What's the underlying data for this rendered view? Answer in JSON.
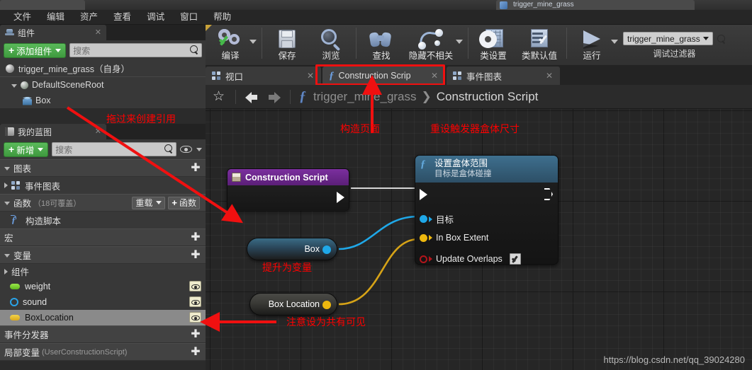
{
  "window": {
    "title": "trigger_mine_grass",
    "doc_tab": ""
  },
  "menu": {
    "items": [
      "文件",
      "编辑",
      "资产",
      "查看",
      "调试",
      "窗口",
      "帮助"
    ]
  },
  "components_panel": {
    "tab_label": "组件",
    "tab_icon": "components-icon",
    "close_glyph": "✕",
    "add_button": "添加组件",
    "search_placeholder": "搜索",
    "tree": [
      {
        "label": "trigger_mine_grass（自身）",
        "icon": "sphere-icon",
        "depth": 0
      },
      {
        "label": "DefaultSceneRoot",
        "icon": "scene-root-icon",
        "depth": 1
      },
      {
        "label": "Box",
        "icon": "box-collision-icon",
        "depth": 2
      }
    ]
  },
  "myblueprint_panel": {
    "tab_label": "我的蓝图",
    "tab_icon": "blueprint-book-icon",
    "close_glyph": "✕",
    "add_button": "新增",
    "search_placeholder": "搜索",
    "sections": {
      "graphs": {
        "title": "图表",
        "add_glyph": "✚"
      },
      "event_graph": {
        "label": "事件图表"
      },
      "functions": {
        "title": "函数",
        "suffix": "（18可覆盖）",
        "override_button": "重载",
        "add_button": "函数",
        "items": [
          {
            "label": "构造脚本"
          }
        ]
      },
      "macros": {
        "title": "宏",
        "add_glyph": "✚"
      },
      "variables": {
        "title": "变量",
        "add_glyph": "✚",
        "group": "组件",
        "items": [
          {
            "label": "weight",
            "pin": "green-pill",
            "selected": false
          },
          {
            "label": "sound",
            "pin": "blue-ring",
            "selected": false
          },
          {
            "label": "BoxLocation",
            "pin": "yellow-pill",
            "selected": true
          }
        ]
      },
      "event_dispatchers": {
        "title": "事件分发器",
        "add_glyph": "✚"
      },
      "local_variables": {
        "title": "局部变量",
        "suffix": "(UserConstructionScript)",
        "add_glyph": "✚"
      }
    }
  },
  "toolbar": {
    "buttons": [
      {
        "label": "编译",
        "icon": "compile-gears-check-icon",
        "has_dropdown": true
      },
      {
        "label": "保存",
        "icon": "save-floppy-icon",
        "has_dropdown": false
      },
      {
        "label": "浏览",
        "icon": "browse-magnifier-icon",
        "has_dropdown": false
      },
      {
        "label": "查找",
        "icon": "find-binoculars-icon",
        "has_dropdown": false
      },
      {
        "label": "隐藏不相关",
        "icon": "hide-unrelated-icon",
        "has_dropdown": true
      },
      {
        "label": "类设置",
        "icon": "class-settings-gear-icon",
        "has_dropdown": false
      },
      {
        "label": "类默认值",
        "icon": "class-defaults-icon",
        "has_dropdown": false
      },
      {
        "label": "运行",
        "icon": "play-run-icon",
        "has_dropdown": true
      }
    ],
    "debug_filter": {
      "value": "trigger_mine_grass",
      "label": "调试过滤器",
      "search_icon": "search-icon"
    }
  },
  "graph_tabs": {
    "tabs": [
      {
        "label": "视口",
        "icon": "viewport-icon",
        "active": false,
        "close_glyph": "✕"
      },
      {
        "label": "Construction Scrip",
        "icon": "function-f-icon",
        "active": true,
        "close_glyph": "✕"
      },
      {
        "label": "事件图表",
        "icon": "event-graph-icon",
        "active": false,
        "close_glyph": "✕"
      }
    ],
    "highlight_color": "#f01010"
  },
  "breadcrumb": {
    "star_glyph": "☆",
    "back_icon": "arrow-left-icon",
    "forward_icon": "arrow-right-icon",
    "f_icon": "function-f-icon",
    "root": "trigger_mine_grass",
    "separator": "❯",
    "current": "Construction Script"
  },
  "graph": {
    "nodes": [
      {
        "id": "construction-script",
        "title": "Construction Script",
        "type": "event",
        "header_color": "#6b2890"
      },
      {
        "id": "set-box-extent",
        "title": "设置盒体范围",
        "subtitle": "目标是盒体碰撞",
        "type": "function-call",
        "header_color": "#35607d",
        "pins": [
          {
            "label": "目标",
            "color": "#1fa8e8",
            "shape": "dot"
          },
          {
            "label": "In Box Extent",
            "color": "#eeb80e",
            "shape": "dot"
          },
          {
            "label": "Update Overlaps",
            "color": "#b3151b",
            "shape": "ring",
            "checkbox": true
          }
        ]
      },
      {
        "id": "box-var",
        "title": "Box",
        "type": "variable-get",
        "pin_color": "#1fa8e8"
      },
      {
        "id": "box-location-var",
        "title": "Box Location",
        "type": "variable-get",
        "pin_color": "#eeb80e"
      }
    ]
  },
  "annotations": [
    {
      "id": "drag-to-create-ref",
      "text": "拖过来创建引用"
    },
    {
      "id": "construction-page",
      "text": "构造页面"
    },
    {
      "id": "reset-trigger-box-size",
      "text": "重设触发器盒体尺寸"
    },
    {
      "id": "promote-to-variable",
      "text": "提升为变量"
    },
    {
      "id": "note-set-public-visible",
      "text": "注意设为共有可见"
    }
  ],
  "watermark": {
    "text": "https://blog.csdn.net/qq_39024280"
  },
  "colors": {
    "annotation_red": "#ff0000",
    "exec_white": "#ffffff",
    "object_blue": "#1fa8e8",
    "vector_yellow": "#eeb80e",
    "bool_red": "#b3151b",
    "accent_green": "#4fae4f"
  }
}
